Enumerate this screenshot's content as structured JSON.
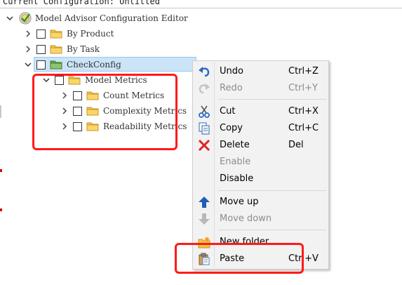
{
  "window": {
    "current_configuration": "Current Configuration: Untitled"
  },
  "tree": {
    "root_label": "Model Advisor Configuration Editor",
    "items": [
      {
        "label": "By Product"
      },
      {
        "label": "By Task"
      },
      {
        "label": "CheckConfig",
        "selected": true
      },
      {
        "label": "Model Metrics"
      },
      {
        "label": "Count Metrics"
      },
      {
        "label": "Complexity Metrics"
      },
      {
        "label": "Readability Metrics"
      }
    ]
  },
  "context_menu": {
    "items": [
      {
        "label": "Undo",
        "shortcut": "Ctrl+Z",
        "icon": "undo-icon",
        "enabled": true
      },
      {
        "label": "Redo",
        "shortcut": "Ctrl+Y",
        "icon": "redo-icon",
        "enabled": false
      },
      {
        "label": "Cut",
        "shortcut": "Ctrl+X",
        "icon": "cut-icon",
        "enabled": true
      },
      {
        "label": "Copy",
        "shortcut": "Ctrl+C",
        "icon": "copy-icon",
        "enabled": true
      },
      {
        "label": "Delete",
        "shortcut": "Del",
        "icon": "delete-icon",
        "enabled": true
      },
      {
        "label": "Enable",
        "shortcut": "",
        "icon": "",
        "enabled": false
      },
      {
        "label": "Disable",
        "shortcut": "",
        "icon": "",
        "enabled": true
      },
      {
        "label": "Move up",
        "shortcut": "",
        "icon": "arrow-up-icon",
        "enabled": true
      },
      {
        "label": "Move down",
        "shortcut": "",
        "icon": "arrow-down-icon",
        "enabled": false
      },
      {
        "label": "New folder",
        "shortcut": "",
        "icon": "new-folder-icon",
        "enabled": true
      },
      {
        "label": "Paste",
        "shortcut": "Ctrl+V",
        "icon": "paste-icon",
        "enabled": true
      }
    ]
  },
  "colors": {
    "annotation": "#ff1a1a",
    "selection": "#cce4f7",
    "folder": "#f5c342",
    "menu_background": "#f2f2f2",
    "disabled_text": "#8c8c8c"
  }
}
